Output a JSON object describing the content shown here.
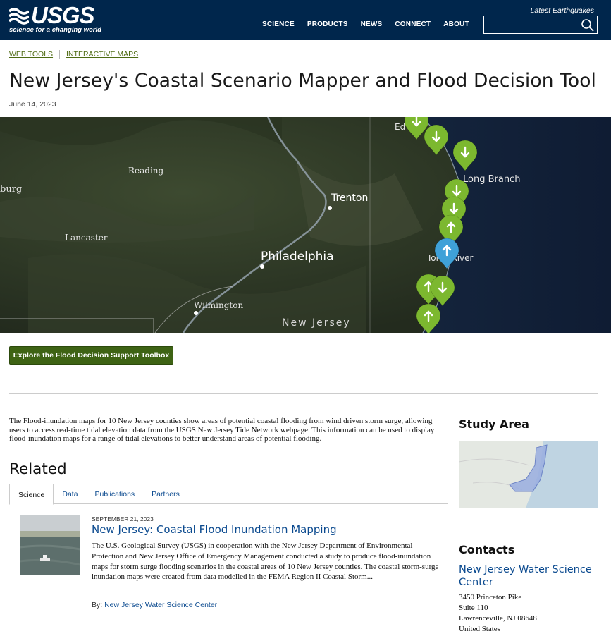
{
  "header": {
    "logo_text": "USGS",
    "logo_tagline": "science for a changing world",
    "nav": [
      "SCIENCE",
      "PRODUCTS",
      "NEWS",
      "CONNECT",
      "ABOUT"
    ],
    "quake_label": "Latest Earthquakes",
    "search_value": "",
    "colors": {
      "bar": "#00264c"
    }
  },
  "breadcrumbs": [
    "WEB TOOLS",
    "INTERACTIVE MAPS"
  ],
  "page": {
    "title": "New Jersey's Coastal Scenario Mapper and Flood Decision Tool",
    "date": "June 14, 2023"
  },
  "map": {
    "labels": [
      "Reading",
      "burg",
      "Trenton",
      "Long Branch",
      "Lancaster",
      "Philadelphia",
      "Toms River",
      "Wilmington",
      "New Jersey",
      "Ed"
    ],
    "markers": [
      {
        "color": "green",
        "arrow": "down"
      },
      {
        "color": "green",
        "arrow": "down"
      },
      {
        "color": "green",
        "arrow": "down"
      },
      {
        "color": "green",
        "arrow": "down"
      },
      {
        "color": "green",
        "arrow": "down"
      },
      {
        "color": "green",
        "arrow": "up"
      },
      {
        "color": "blue",
        "arrow": "up"
      },
      {
        "color": "green",
        "arrow": "up"
      },
      {
        "color": "green",
        "arrow": "down"
      },
      {
        "color": "green",
        "arrow": "up"
      }
    ]
  },
  "cta_label": "Explore the Flood Decision Support Toolbox",
  "description": "The Flood-inundation maps for 10 New Jersey counties show areas of potential coastal flooding from wind driven storm surge, allowing users to access real-time tidal elevation data from the USGS New Jersey Tide Network webpage. This information can be used to display flood-inundation maps for a range of tidal elevations to better understand areas of potential flooding.",
  "related": {
    "heading": "Related",
    "tabs": [
      "Science",
      "Data",
      "Publications",
      "Partners"
    ],
    "active_tab": "Science",
    "card": {
      "date": "SEPTEMBER 21, 2023",
      "title": "New Jersey: Coastal Flood Inundation Mapping",
      "body": "The U.S. Geological Survey (USGS) in cooperation with the New Jersey Department of Environmental Protection and New Jersey Office of Emergency Management conducted a study to produce flood-inundation maps for storm surge flooding scenarios in the coastal areas of 10 New Jersey counties. The coastal storm-surge inundation maps were created from data modelled in the FEMA Region II Coastal Storm...",
      "by_label": "By:",
      "by_link": "New Jersey Water Science Center"
    }
  },
  "sidebar": {
    "study_area_heading": "Study Area",
    "contacts_heading": "Contacts",
    "contact_name": "New Jersey Water Science Center",
    "address": [
      "3450 Princeton Pike",
      "Suite 110",
      "Lawrenceville, NJ 08648",
      "United States"
    ]
  },
  "colors": {
    "link": "#0b4a8f",
    "cta": "#3e6314",
    "breadcrumb": "#4e6b12",
    "marker_green": "#7cb82f",
    "marker_blue": "#3fa1d8"
  }
}
